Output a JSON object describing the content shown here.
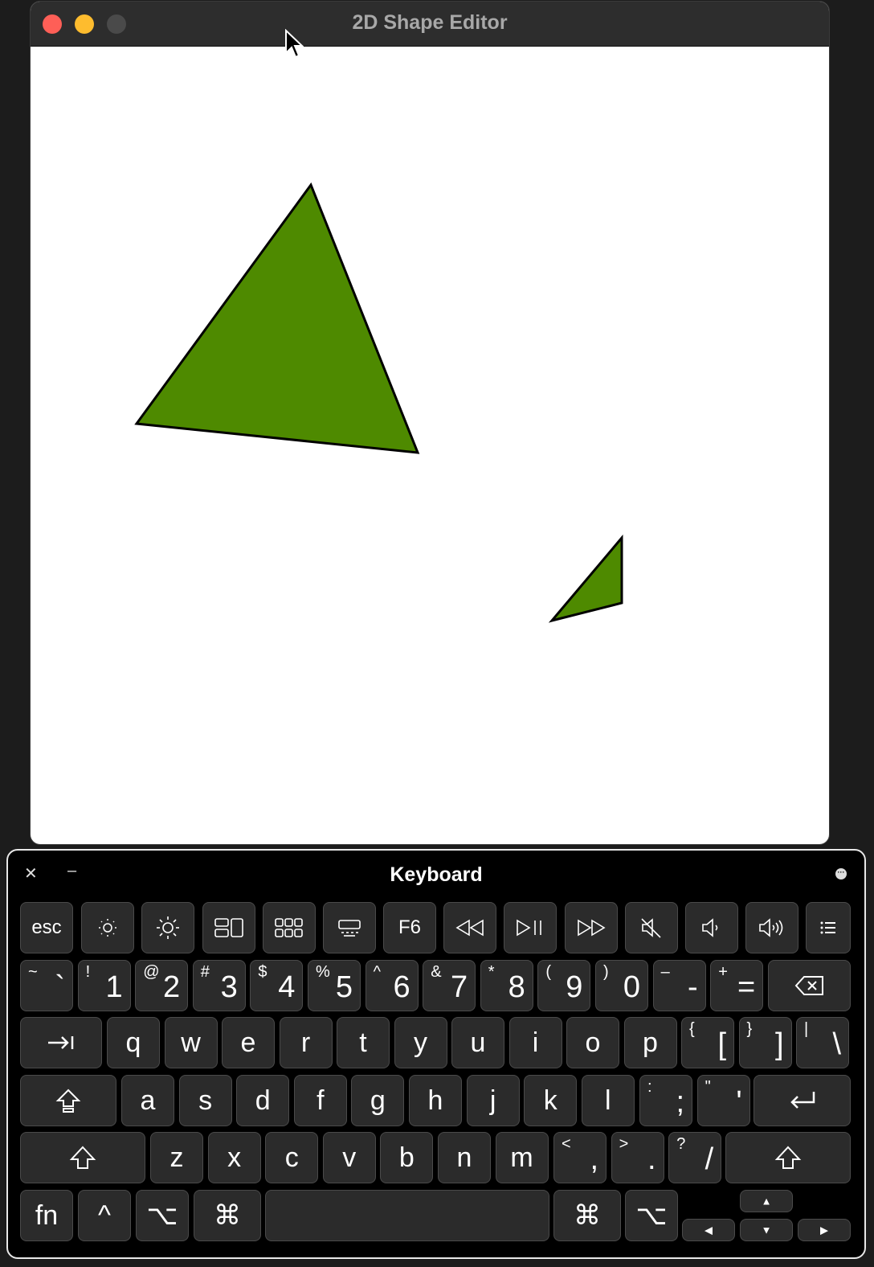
{
  "window": {
    "title": "2D Shape Editor",
    "traffic_lights": [
      "close",
      "minimize",
      "zoom"
    ]
  },
  "canvas": {
    "shapes": [
      {
        "type": "triangle",
        "fill": "#4e8a00",
        "stroke": "#000000"
      },
      {
        "type": "triangle",
        "fill": "#4e8a00",
        "stroke": "#000000"
      }
    ]
  },
  "keyboard": {
    "title": "Keyboard",
    "close_glyph": "✕",
    "minimize_glyph": "–",
    "more_glyph": "•••",
    "function_row": {
      "esc": "esc",
      "f6": "F6",
      "icons": [
        "brightness-down-icon",
        "brightness-up-icon",
        "mission-control-icon",
        "launchpad-icon",
        "keyboard-backlight-icon",
        "rewind-icon",
        "play-pause-icon",
        "fast-forward-icon",
        "mute-icon",
        "volume-down-icon",
        "volume-up-icon",
        "list-icon"
      ]
    },
    "number_row": [
      {
        "shift": "~",
        "main": "`"
      },
      {
        "shift": "!",
        "main": "1"
      },
      {
        "shift": "@",
        "main": "2"
      },
      {
        "shift": "#",
        "main": "3"
      },
      {
        "shift": "$",
        "main": "4"
      },
      {
        "shift": "%",
        "main": "5"
      },
      {
        "shift": "^",
        "main": "6"
      },
      {
        "shift": "&",
        "main": "7"
      },
      {
        "shift": "*",
        "main": "8"
      },
      {
        "shift": "(",
        "main": "9"
      },
      {
        "shift": ")",
        "main": "0"
      },
      {
        "shift": "–",
        "main": "-"
      },
      {
        "shift": "+",
        "main": "="
      }
    ],
    "qwerty_row": [
      "q",
      "w",
      "e",
      "r",
      "t",
      "y",
      "u",
      "i",
      "o",
      "p"
    ],
    "bracket_keys": [
      {
        "shift": "{",
        "main": "["
      },
      {
        "shift": "}",
        "main": "]"
      },
      {
        "shift": "|",
        "main": "\\"
      }
    ],
    "home_row": [
      "a",
      "s",
      "d",
      "f",
      "g",
      "h",
      "j",
      "k",
      "l"
    ],
    "home_punct": [
      {
        "shift": ":",
        "main": ";"
      },
      {
        "shift": "\"",
        "main": "'"
      }
    ],
    "bottom_row": [
      "z",
      "x",
      "c",
      "v",
      "b",
      "n",
      "m"
    ],
    "bottom_punct": [
      {
        "shift": "<",
        "main": ","
      },
      {
        "shift": ">",
        "main": "."
      },
      {
        "shift": "?",
        "main": "/"
      }
    ],
    "modifiers": {
      "fn": "fn",
      "control": "^",
      "option": "⌥",
      "command": "⌘",
      "tab": "⇥",
      "caps": "⇪",
      "shift": "⇧",
      "return": "⏎",
      "delete": "⌫",
      "arrow_up": "▲",
      "arrow_down": "▼",
      "arrow_left": "◀",
      "arrow_right": "▶"
    }
  }
}
